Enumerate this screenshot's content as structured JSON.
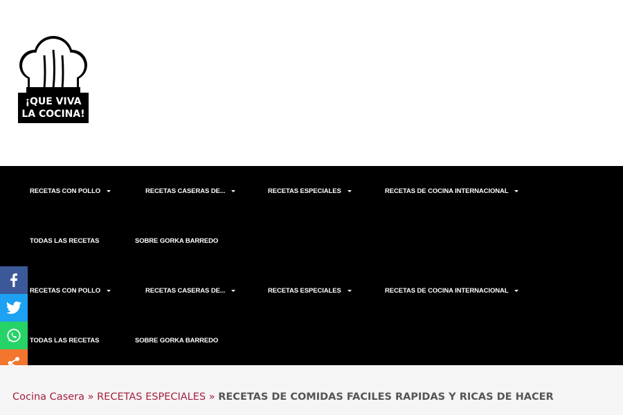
{
  "header": {
    "logo": {
      "line1": "¡QUE VIVA",
      "line2": "LA COCINA!"
    }
  },
  "nav": {
    "rows": [
      [
        "RECETAS CON POLLO",
        "RECETAS CASERAS DE...",
        "RECETAS ESPECIALES",
        "RECETAS DE COCINA INTERNACIONAL"
      ],
      [
        "TODAS LAS RECETAS",
        "SOBRE GORKA BARREDO"
      ],
      [
        "RECETAS CON POLLO",
        "RECETAS CASERAS DE...",
        "RECETAS ESPECIALES",
        "RECETAS DE COCINA INTERNACIONAL"
      ],
      [
        "TODAS LAS RECETAS",
        "SOBRE GORKA BARREDO"
      ]
    ]
  },
  "share": {
    "buttons": [
      {
        "name": "facebook",
        "color": "#3b5998",
        "icon": "facebook-icon"
      },
      {
        "name": "twitter",
        "color": "#1da1f2",
        "icon": "twitter-icon"
      },
      {
        "name": "whatsapp",
        "color": "#25d366",
        "icon": "whatsapp-icon"
      },
      {
        "name": "more",
        "color": "#f2762e",
        "icon": "share-icon"
      }
    ]
  },
  "breadcrumb": {
    "home": "Cocina Casera",
    "sep": "»",
    "category": "RECETAS ESPECIALES",
    "current": "RECETAS DE COMIDAS FACILES RAPIDAS Y RICAS DE HACER"
  },
  "colors": {
    "link": "#a31f3c",
    "nav_bg": "#000000",
    "crumb_bg": "#f5f5f5"
  }
}
